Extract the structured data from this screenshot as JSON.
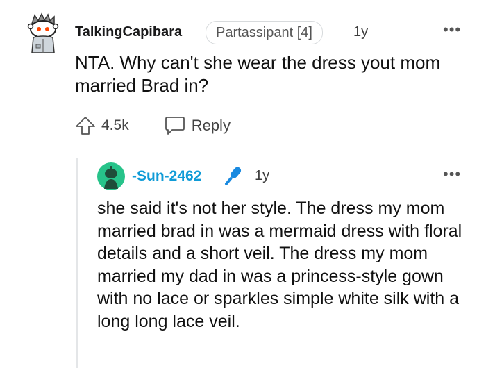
{
  "comment": {
    "username": "TalkingCapibara",
    "flair": "Partassipant [4]",
    "time": "1y",
    "more": "•••",
    "body": "NTA. Why can't she wear the dress yout mom married Brad in?",
    "score": "4.5k",
    "reply_label": "Reply"
  },
  "reply": {
    "username": "-Sun-2462",
    "time": "1y",
    "more": "•••",
    "body": "she said it's not her style. The dress my mom married brad in was a mermaid dress with floral details and a short veil. The dress my mom married my dad in was a princess-style gown with no lace or sparkles simple white silk with a long long lace veil."
  },
  "icons": {
    "top_avatar": "snoo-avatar-icon",
    "reply_avatar": "snoo-avatar-icon",
    "upvote": "upvote-arrow-icon",
    "reply": "comment-bubble-icon",
    "mic": "microphone-icon",
    "more": "more-options-icon"
  },
  "colors": {
    "reply_username": "#0f9bd7",
    "reply_avatar_bg": "#27c38a",
    "mic": "#1a8ae0",
    "snoo_eye": "#ff4500"
  }
}
